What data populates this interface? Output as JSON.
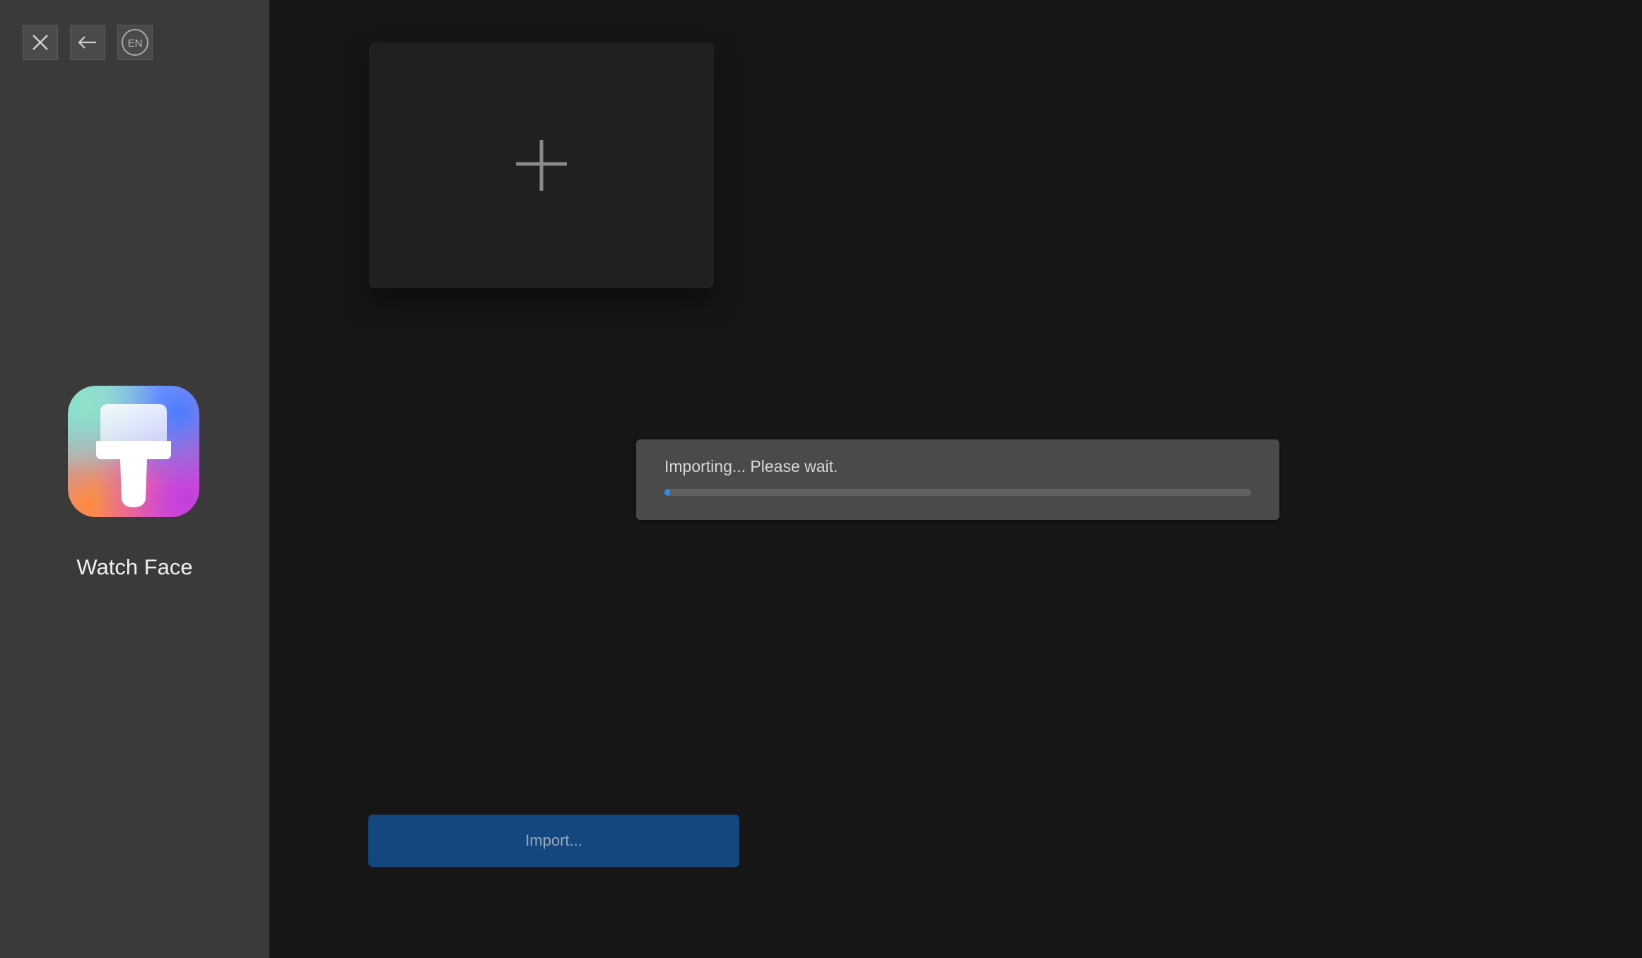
{
  "window_controls": {
    "close_icon": "close-icon",
    "back_icon": "arrow-left-icon",
    "language_label": "EN"
  },
  "sidebar": {
    "app_icon": "paintbrush-icon",
    "app_name": "Watch Face"
  },
  "main": {
    "add_card_icon": "plus-icon",
    "progress": {
      "message": "Importing... Please wait.",
      "value": 0.01
    },
    "import_button_label": "Import..."
  },
  "colors": {
    "sidebar_bg": "#3a3a3a",
    "main_bg": "#161616",
    "accent": "#2a8ee8",
    "import_button_bg": "#14467f"
  }
}
